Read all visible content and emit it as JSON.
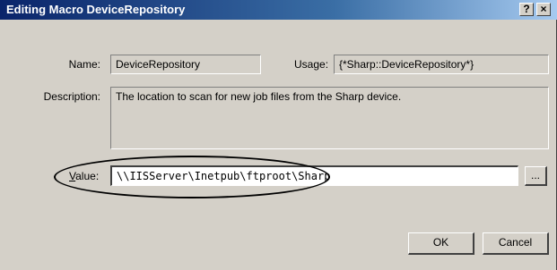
{
  "window": {
    "title": "Editing Macro DeviceRepository",
    "help_button": "?",
    "close_button": "×"
  },
  "form": {
    "name_label": "Name:",
    "name_value": "DeviceRepository",
    "usage_label": "Usage:",
    "usage_value": "{*Sharp::DeviceRepository*}",
    "description_label": "Description:",
    "description_value": "The location to scan for new job files from the Sharp device.",
    "value_label_hotkey": "V",
    "value_label_rest": "alue:",
    "value_value": "\\\\IISServer\\Inetpub\\ftproot\\Sharp",
    "browse_label": "..."
  },
  "buttons": {
    "ok_label": "OK",
    "cancel_label": "Cancel"
  }
}
